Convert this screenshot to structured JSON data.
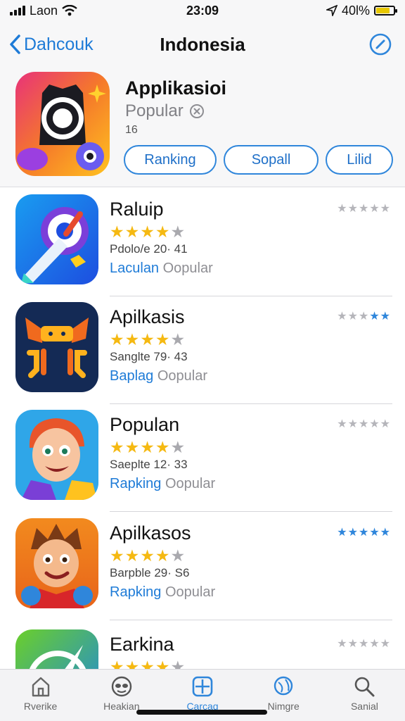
{
  "status_bar": {
    "carrier": "Laon",
    "time": "23:09",
    "battery_text": "40l%",
    "battery_level": 0.8
  },
  "nav": {
    "back_label": "Dahcouk",
    "title": "Indonesia"
  },
  "header": {
    "title": "Applikasioi",
    "subtitle": "Popular",
    "count": "16",
    "buttons": [
      "Ranking",
      "Sopall",
      "Lilid"
    ]
  },
  "apps": [
    {
      "name": "Raluip",
      "stars": 4,
      "meta": "Pdolo/e 20· 41",
      "tag1": "Laculan",
      "tag2": "Oopular",
      "rating_stars": 5,
      "rating_color": "gray",
      "icon": "rocket-icon"
    },
    {
      "name": "Apilkasis",
      "stars": 4,
      "meta": "Sanglte 79· 43",
      "tag1": "Baplag",
      "tag2": "Oopular",
      "rating_stars": 5,
      "rating_color": "gray",
      "icon": "robot-mask-icon"
    },
    {
      "name": "Populan",
      "stars": 4,
      "meta": "Saeplte 12· 33",
      "tag1": "Rapking",
      "tag2": "Oopular",
      "rating_stars": 5,
      "rating_color": "gray",
      "icon": "cartoon-kid-icon"
    },
    {
      "name": "Apilkasos",
      "stars": 4,
      "meta": "Barpble 29· S6",
      "tag1": "Rapking",
      "tag2": "Oopular",
      "rating_stars": 5,
      "rating_color": "blue",
      "icon": "cartoon-boy-icon"
    },
    {
      "name": "Earkina",
      "stars": 4,
      "meta": "",
      "tag1": "",
      "tag2": "",
      "rating_stars": 5,
      "rating_color": "gray",
      "icon": "compass-icon"
    }
  ],
  "tabs": [
    {
      "label": "Rverike",
      "icon": "home-icon",
      "active": false
    },
    {
      "label": "Heakian",
      "icon": "mask-icon",
      "active": false
    },
    {
      "label": "Carcaq",
      "icon": "grid-icon",
      "active": true
    },
    {
      "label": "Nimgre",
      "icon": "globe-icon",
      "active": false
    },
    {
      "label": "Sanial",
      "icon": "search-icon",
      "active": false
    }
  ],
  "colors": {
    "accent": "#2f86db",
    "star": "#f5b912",
    "star_empty": "#a9a9ae"
  }
}
